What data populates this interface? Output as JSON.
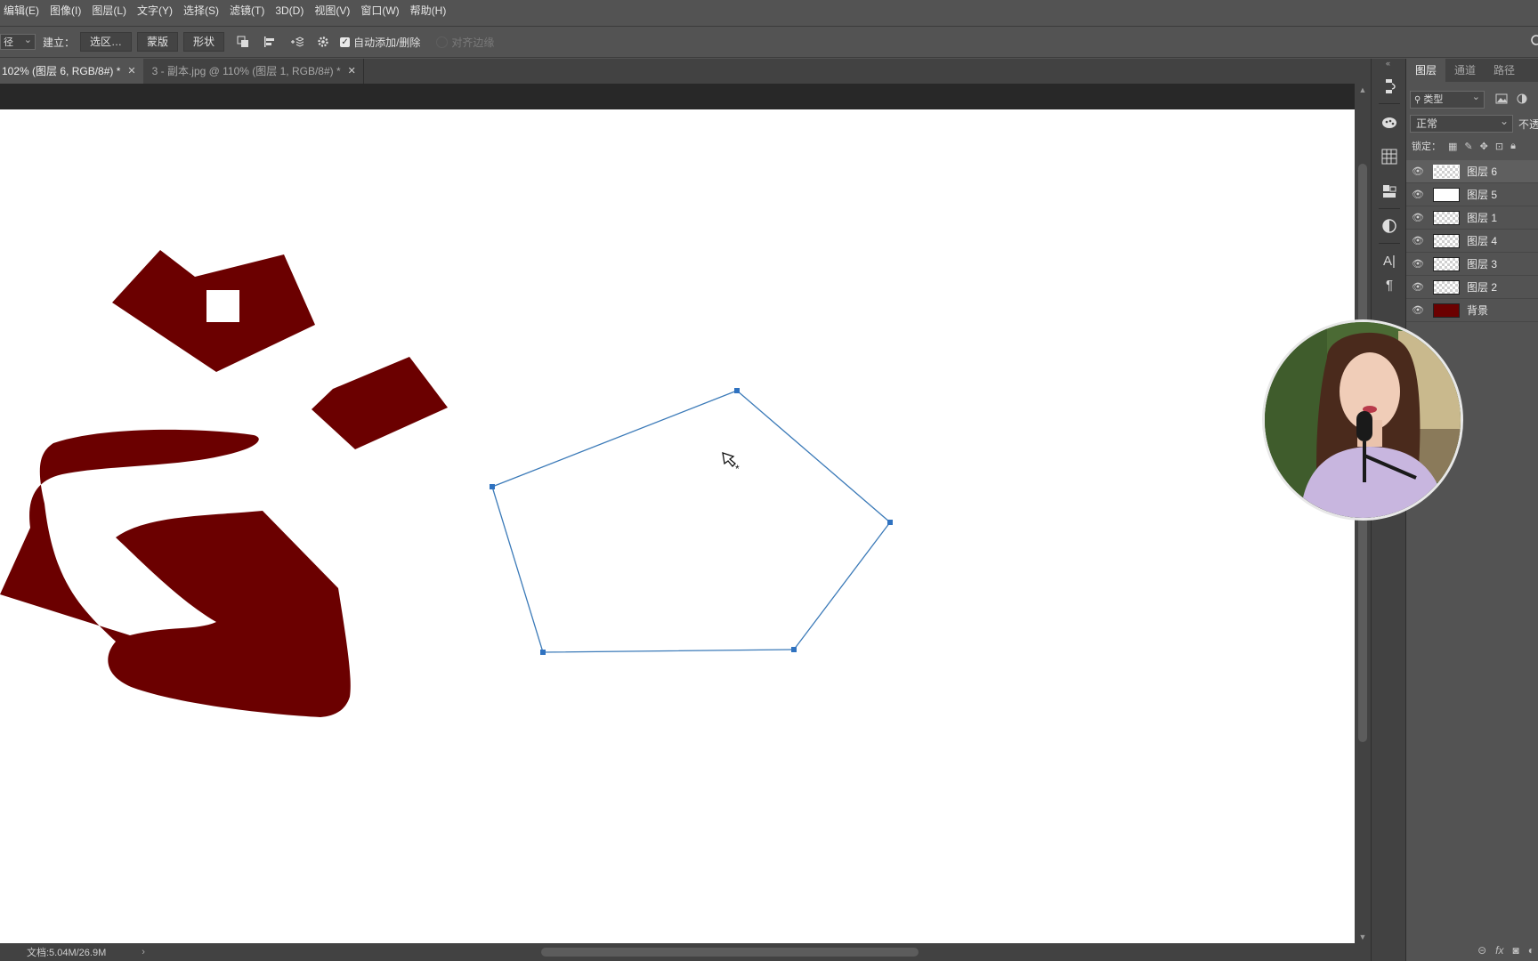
{
  "menu": [
    "编辑(E)",
    "图像(I)",
    "图层(L)",
    "文字(Y)",
    "选择(S)",
    "滤镜(T)",
    "3D(D)",
    "视图(V)",
    "窗口(W)",
    "帮助(H)"
  ],
  "options": {
    "mode_select": "径",
    "create_label": "建立：",
    "selection_button": "选区…",
    "mask_button": "蒙版",
    "shape_button": "形状",
    "auto_add_delete_label": "自动添加/删除",
    "align_edges_label": "对齐边缘"
  },
  "tabs": [
    {
      "label": "102% (图层 6, RGB/8#) *",
      "active": true
    },
    {
      "label": "3 - 副本.jpg @ 110% (图层 1, RGB/8#) *",
      "active": false
    }
  ],
  "status": {
    "doc_info": "文档:5.04M/26.9M",
    "chevron": "›"
  },
  "layers_panel": {
    "tabs": [
      "图层",
      "通道",
      "路径"
    ],
    "filter_label": "类型",
    "blend_mode": "正常",
    "opacity_label": "不透",
    "lock_label": "锁定：",
    "layers": [
      {
        "name": "图层 6",
        "thumb": "transparent",
        "selected": true
      },
      {
        "name": "图层 5",
        "thumb": "white",
        "selected": false
      },
      {
        "name": "图层 1",
        "thumb": "transparent",
        "selected": false
      },
      {
        "name": "图层 4",
        "thumb": "transparent",
        "selected": false
      },
      {
        "name": "图层 3",
        "thumb": "transparent",
        "selected": false
      },
      {
        "name": "图层 2",
        "thumb": "transparent",
        "selected": false
      },
      {
        "name": "背景",
        "thumb": "red",
        "selected": false
      }
    ]
  },
  "colors": {
    "shape_fill": "#6b0000",
    "path_stroke": "#3b7ab8",
    "anchor": "#2f72c0"
  }
}
